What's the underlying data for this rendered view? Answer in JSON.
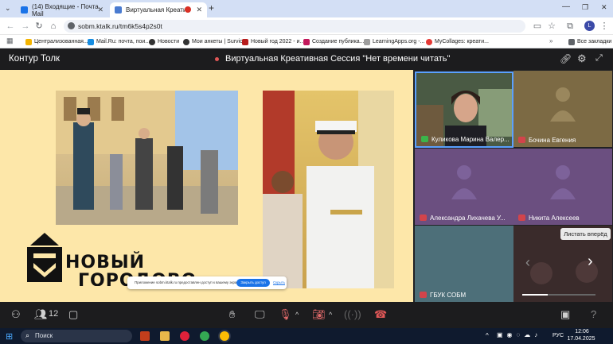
{
  "browser": {
    "tabs": [
      {
        "title": "(14) Входящие - Почта Mail",
        "active": false
      },
      {
        "title": "Виртуальная Креативная С",
        "active": true
      }
    ],
    "url": "sobm.ktalk.ru/tm6k5s4p2s0t",
    "bookmarks": [
      "Централизованная...",
      "Mail.Ru: почта, пои...",
      "Новости",
      "Мои анкеты | Survio",
      "Новый год 2022 - и...",
      "Создание публика...",
      "LearningApps.org -...",
      "MyCollages: креати..."
    ],
    "all_bookmarks": "Все закладки",
    "profile_letter": "L"
  },
  "app": {
    "brand": "Контур Толк",
    "session_title": "Виртуальная Креативная Сессия \"Нет времени читать\"",
    "accent": "#5aa0ff",
    "participants_count": "12"
  },
  "stage": {
    "logo_line1": "НОВЫЙ",
    "logo_line2": "ГОРОДОВОЙ",
    "toast_text": "Приложение sobm.ktalk.ru предоставлен доступ к вашему экрану.",
    "toast_button": "Закрыть доступ",
    "toast_link": "Скрыть"
  },
  "participants": [
    {
      "name": "Куликова Марина Валер...",
      "video": true,
      "muted": false
    },
    {
      "name": "Бочина Евгения",
      "video": false,
      "muted": true
    },
    {
      "name": "Александра Лихачева У...",
      "video": false,
      "muted": true
    },
    {
      "name": "Никита Алексеев",
      "video": false,
      "muted": true
    },
    {
      "name": "ГБУК СОБМ",
      "video": false,
      "muted": true
    }
  ],
  "pager": {
    "tooltip": "Листать вперёд",
    "progress": 0.35
  },
  "taskbar": {
    "search_placeholder": "Поиск",
    "lang": "РУС",
    "time": "12:06",
    "date": "17.04.2025"
  }
}
